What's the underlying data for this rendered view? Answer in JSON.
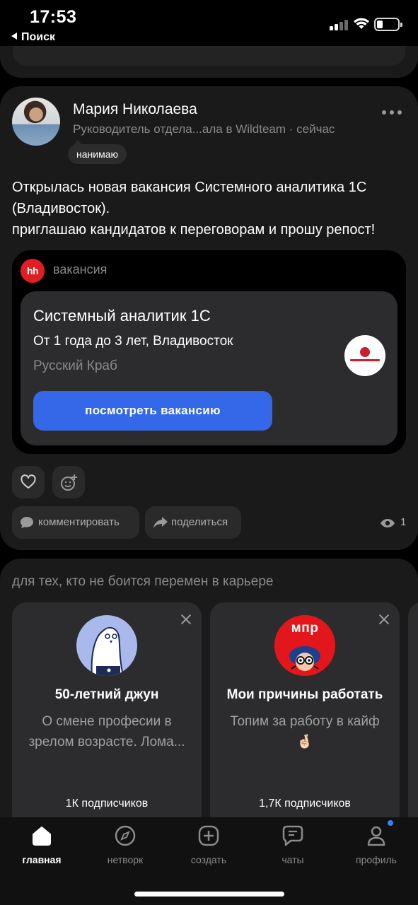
{
  "status_bar": {
    "time": "17:53",
    "back_label": "Поиск",
    "battery_level": 0.2
  },
  "post": {
    "author_name": "Мария Николаева",
    "author_subtitle": "Руководитель отдела...ала в Wildteam · сейчас",
    "badge": "нанимаю",
    "text_lines": [
      "Открылась новая вакансия Системного аналитика 1С",
      "(Владивосток).",
      "приглашаю кандидатов к переговорам и прошу репост!"
    ],
    "vacancy": {
      "source_logo": "hh",
      "source_label": "вакансия",
      "title": "Системный аналитик 1С",
      "experience_location": "От 1 года до 3 лет, Владивосток",
      "company": "Русский Краб",
      "button": "посмотреть вакансию"
    },
    "actions": {
      "like_icon": "heart-icon",
      "react_icon": "add-emoji-icon",
      "comment_label": "комментировать",
      "share_label": "поделиться",
      "views_count": "1"
    }
  },
  "recommendations": {
    "heading": "для тех, кто не боится перемен в карьере",
    "channels": [
      {
        "title": "50-летний джун",
        "description": "О смене професии в зрелом возрасте. Лома...",
        "subscribers": "1К подписчиков"
      },
      {
        "title": "Мои причины работать",
        "description": "Топим за работу в кайф 🤞🏻",
        "avatar_text": "мпр",
        "subscribers": "1,7К подписчиков"
      }
    ]
  },
  "tab_bar": {
    "tabs": [
      {
        "label": "главная",
        "icon": "home-icon"
      },
      {
        "label": "нетворк",
        "icon": "compass-icon"
      },
      {
        "label": "создать",
        "icon": "plus-square-icon"
      },
      {
        "label": "чаты",
        "icon": "chat-icon"
      },
      {
        "label": "профиль",
        "icon": "profile-icon"
      }
    ],
    "active_tab": "главная",
    "accent": "#3a7bff"
  },
  "colors": {
    "primary_button": "#3568e8",
    "hh_brand": "#e11e24"
  }
}
